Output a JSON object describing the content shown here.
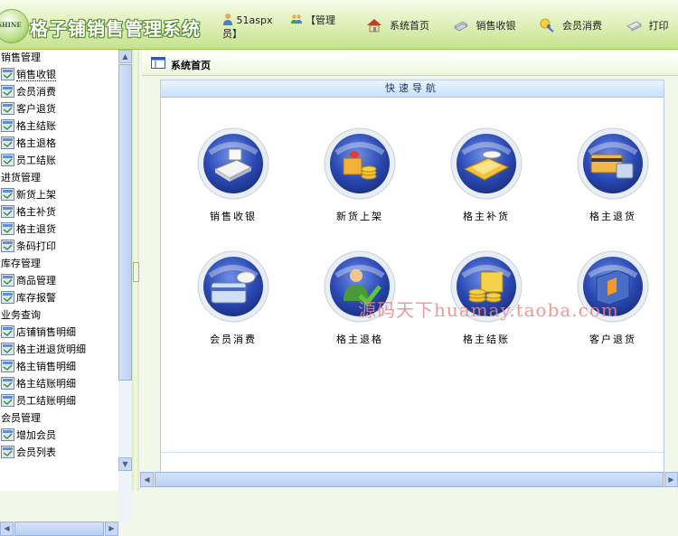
{
  "header": {
    "logo_text": "SHINE",
    "app_title": "格子铺销售管理系统",
    "user": {
      "name": "51aspx",
      "role": "【管理员】"
    },
    "nav": [
      {
        "label": "系统首页",
        "icon": "house-icon"
      },
      {
        "label": "销售收银",
        "icon": "money-icon"
      },
      {
        "label": "会员消费",
        "icon": "member-icon"
      },
      {
        "label": "打印",
        "icon": "printer-icon"
      }
    ]
  },
  "sidebar": {
    "groups": [
      {
        "title": "销售管理",
        "items": [
          "销售收银",
          "会员消费",
          "客户退货",
          "格主结账",
          "格主退格",
          "员工结账"
        ]
      },
      {
        "title": "进货管理",
        "items": [
          "新货上架",
          "格主补货",
          "格主退货",
          "条码打印"
        ]
      },
      {
        "title": "库存管理",
        "items": [
          "商品管理",
          "库存报警"
        ]
      },
      {
        "title": "业务查询",
        "items": [
          "店铺销售明细",
          "格主进退货明细",
          "格主销售明细",
          "格主结账明细",
          "员工结账明细"
        ]
      },
      {
        "title": "会员管理",
        "items": [
          "增加会员",
          "会员列表"
        ]
      }
    ]
  },
  "main": {
    "page_title": "系统首页",
    "panel_title": "快速导航",
    "tiles": [
      {
        "label": "销售收银",
        "icon": "cash-register-icon"
      },
      {
        "label": "新货上架",
        "icon": "new-goods-icon"
      },
      {
        "label": "格主补货",
        "icon": "restock-icon"
      },
      {
        "label": "格主退货",
        "icon": "return-goods-icon"
      },
      {
        "label": "会员消费",
        "icon": "member-card-icon"
      },
      {
        "label": "格主退格",
        "icon": "exit-lease-icon"
      },
      {
        "label": "格主结账",
        "icon": "settlement-icon"
      },
      {
        "label": "客户退货",
        "icon": "customer-return-icon"
      }
    ],
    "watermark": "源码天下huamay.taoba.com"
  },
  "colors": {
    "header_green": "#c6e28e",
    "title_outline": "#4d8a24",
    "orb_blue": "#1f3fa6",
    "panel_head": "#c9e2fb",
    "watermark": "#e58b8b"
  }
}
